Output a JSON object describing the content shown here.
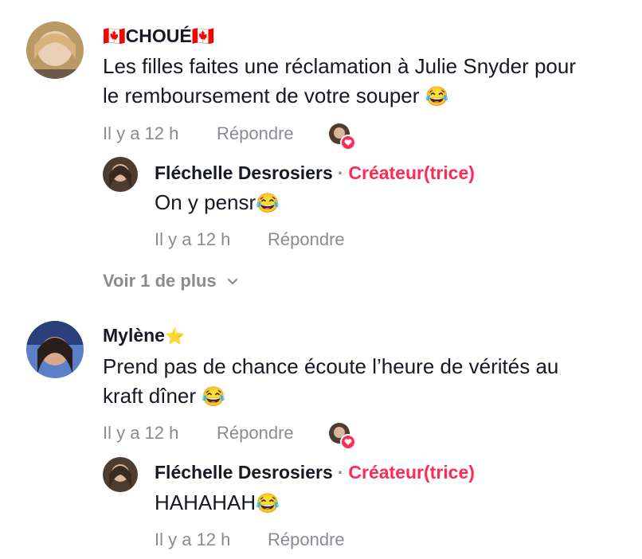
{
  "comments": [
    {
      "username": "🇨🇦CHOUÉ🇨🇦",
      "text_line1": "Les filles faites une réclamation à Julie Snyder pour",
      "text_line2": "le remboursement de votre souper",
      "emoji": "😂",
      "time": "Il y a 12 h",
      "reply_label": "Répondre",
      "reply": {
        "username": "Fléchelle Desrosiers",
        "separator": "·",
        "badge": "Créateur(trice)",
        "text": "On y pensr",
        "emoji": "😂",
        "time": "Il y a 12 h",
        "reply_label": "Répondre"
      },
      "view_more": "Voir 1 de plus"
    },
    {
      "username": "Mylène",
      "username_emoji": "⭐",
      "text_line1": "Prend pas de chance écoute l’heure de vérités au",
      "text_line2": "kraft dîner",
      "emoji": "😂",
      "time": "Il y a 12 h",
      "reply_label": "Répondre",
      "reply": {
        "username": "Fléchelle Desrosiers",
        "separator": "·",
        "badge": "Créateur(trice)",
        "text": "HAHAHAH",
        "emoji": "😂",
        "time": "Il y a 12 h",
        "reply_label": "Répondre"
      }
    }
  ],
  "colors": {
    "accent": "#fe2c55",
    "meta_gray": "#8a8b91",
    "text": "#161823"
  },
  "icons": {
    "liked_by_creator": "heart-icon",
    "view_more": "chevron-down-icon"
  }
}
